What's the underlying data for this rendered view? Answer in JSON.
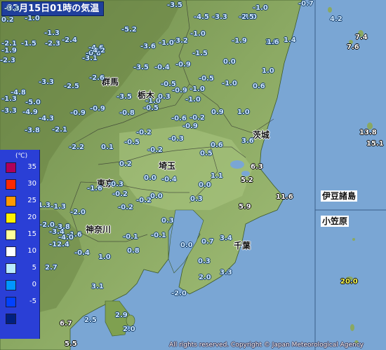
{
  "title": "02月15日01時の気温",
  "legend": {
    "unit": "(℃)",
    "items": [
      {
        "label": "35",
        "color": "#b0005a"
      },
      {
        "label": "30",
        "color": "#ff2800"
      },
      {
        "label": "25",
        "color": "#ff9900"
      },
      {
        "label": "20",
        "color": "#fff200"
      },
      {
        "label": "15",
        "color": "#ffff99"
      },
      {
        "label": "10",
        "color": "#ffffff"
      },
      {
        "label": "5",
        "color": "#b9ebff"
      },
      {
        "label": "0",
        "color": "#0096ff"
      },
      {
        "label": "-5",
        "color": "#0041ff"
      },
      {
        "label": "",
        "color": "#002080"
      }
    ]
  },
  "prefectures": {
    "gunma": "群馬",
    "tochigi": "栃木",
    "ibaraki": "茨城",
    "saitama": "埼玉",
    "tokyo": "東京",
    "kanagawa": "神奈川",
    "chiba": "千葉"
  },
  "insets": {
    "izu": "伊豆諸島",
    "ogasawara": "小笠原"
  },
  "copyright": "All rights reserved. Copyright © Japan Meteorological Agency",
  "temperatures": [
    "-3.5",
    "-3.3",
    "-1.0",
    "-0.7",
    "-1.0",
    "0.2",
    "-1.0",
    "-3.3",
    "-4.5",
    "-2.5",
    "1.6",
    "-5.2",
    "-3.2",
    "-0.8",
    "-3.6",
    "-1.9",
    "-1.0",
    "-1.5",
    "4.2",
    "-1.3",
    "-2.4",
    "-1.5",
    "-2.1",
    "-1.0",
    "-1.9",
    "-4.6",
    "1.6",
    "1.4",
    "-2.3",
    "-4.2",
    "-3.1",
    "0.0",
    "7.4",
    "7.6",
    "-2.3",
    "-3.5",
    "-0.4",
    "-0.9",
    "1.0",
    "-2.6",
    "-0.5",
    "-3.3",
    "-2.5",
    "-1.0",
    "-0.5",
    "-1.0",
    "-0.9",
    "0.6",
    "-4.8",
    "-1.3",
    "-3.5",
    "-1.0",
    "-5.0",
    "-0.9",
    "-1.0",
    "0.3",
    "-0.5",
    "0.9",
    "1.0",
    "-3.3",
    "-4.9",
    "-0.9",
    "-0.8",
    "-0.6",
    "-4.3",
    "-0.2",
    "-0.9",
    "-3.8",
    "-2.1",
    "-0.2",
    "13.8",
    "15.1",
    "-2.2",
    "0.1",
    "-0.2",
    "0.5",
    "3.6",
    "0.6",
    "-0.3",
    "-0.5",
    "0.2",
    "0.0",
    "6.3",
    "1.1",
    "5.2",
    "-1.6",
    "-0.3",
    "-0.4",
    "0.0",
    "11.6",
    "-0.2",
    "-1.3",
    "0.0",
    "-0.2",
    "0.3",
    "-0.2",
    "5.9",
    "-2.0",
    "0.3",
    "-3.8",
    "-1.6",
    "-4.0",
    "-0.1",
    "-0.1",
    "0.7",
    "3.4",
    "-0.4",
    "0.8",
    "0.0",
    "2.7",
    "0.3",
    "1.0",
    "2.0",
    "3.3",
    "3.1",
    "20.0",
    "-2.0",
    "2.9",
    "6.7",
    "2.5",
    "2.0",
    "5.5",
    "-1.3",
    "-2.0",
    "-12.4",
    "-3.4"
  ]
}
